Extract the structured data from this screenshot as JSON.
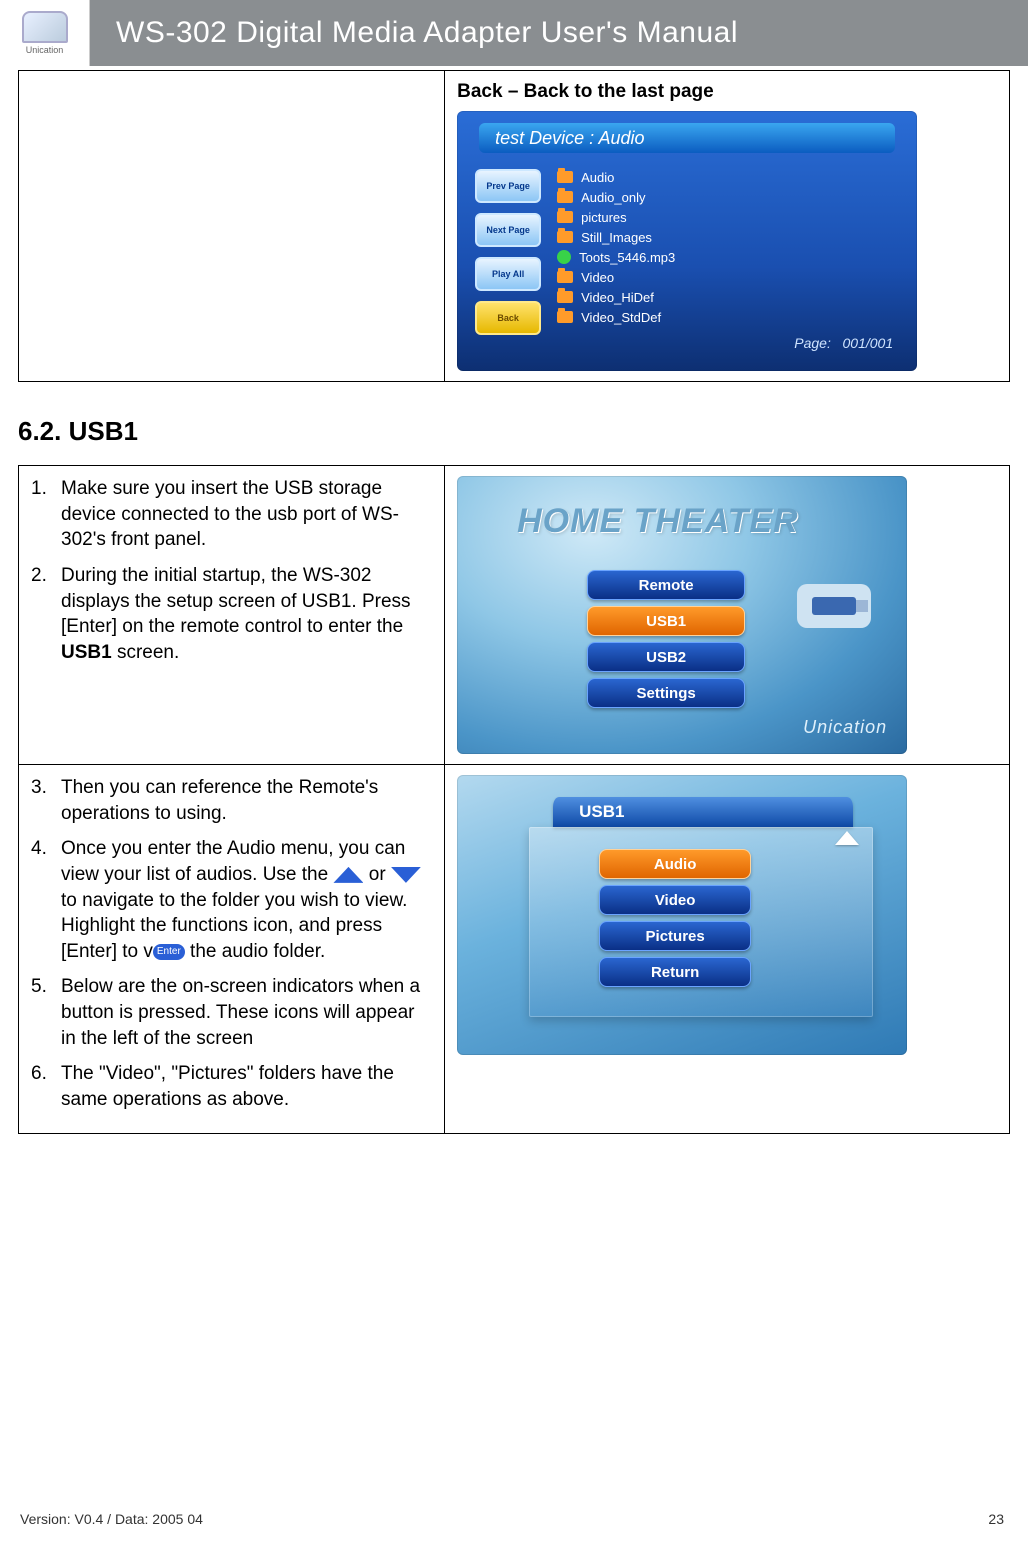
{
  "header": {
    "logo_caption": "Unication",
    "title": "WS-302 Digital Media Adapter User's Manual"
  },
  "top_table": {
    "back_caption": "Back – Back to the last page",
    "shot1": {
      "title": "test  Device  :  Audio",
      "side_buttons": [
        "Prev Page",
        "Next Page",
        "Play All",
        "Back"
      ],
      "files": [
        {
          "icon": "folder",
          "name": "Audio"
        },
        {
          "icon": "folder",
          "name": "Audio_only"
        },
        {
          "icon": "folder",
          "name": "pictures"
        },
        {
          "icon": "folder",
          "name": "Still_Images"
        },
        {
          "icon": "note",
          "name": "Toots_5446.mp3"
        },
        {
          "icon": "folder",
          "name": "Video"
        },
        {
          "icon": "folder",
          "name": "Video_HiDef"
        },
        {
          "icon": "folder",
          "name": "Video_StdDef"
        }
      ],
      "pager_label": "Page:",
      "pager_value": "001/001"
    }
  },
  "section62_heading": "6.2. USB1",
  "row1": {
    "steps": [
      {
        "n": "1.",
        "text": "Make sure you insert the USB storage device connected to the usb port of WS-302's front panel."
      },
      {
        "n": "2.",
        "text_pre": "During the initial startup, the WS-302 displays the setup screen of USB1. Press [Enter] on the remote control to enter the ",
        "bold": "USB1",
        "text_post": " screen."
      }
    ],
    "shot2": {
      "title": "HOME THEATER",
      "menu": [
        {
          "label": "Remote",
          "sel": false
        },
        {
          "label": "USB1",
          "sel": true
        },
        {
          "label": "USB2",
          "sel": false
        },
        {
          "label": "Settings",
          "sel": false
        }
      ],
      "usb_label": "USB",
      "brand": "Unication"
    }
  },
  "row2": {
    "steps": [
      {
        "n": "3.",
        "text": "Then you can reference the Remote's operations to using."
      },
      {
        "n": "4.",
        "seg1": "Once you enter the Audio menu, you can view your list of audios. Use the ",
        "or": " or ",
        "seg2": " to navigate to the folder you wish to view. Highlight the functions icon, and press",
        "seg3_pre": "[Enter] to view the audio folder.",
        "enter_badge": "Enter"
      },
      {
        "n": "5.",
        "text": "Below are the on-screen indicators when a button is pressed. These icons will appear in the left of the screen"
      },
      {
        "n": "6.",
        "text": "The \"Video\", \"Pictures\" folders have the same operations as above."
      }
    ],
    "shot3": {
      "tab": "USB1",
      "menu": [
        {
          "label": "Audio",
          "sel": true
        },
        {
          "label": "Video",
          "sel": false
        },
        {
          "label": "Pictures",
          "sel": false
        },
        {
          "label": "Return",
          "sel": false
        }
      ]
    }
  },
  "footer": {
    "version": "Version: V0.4 / Data: 2005 04",
    "page": "23"
  }
}
